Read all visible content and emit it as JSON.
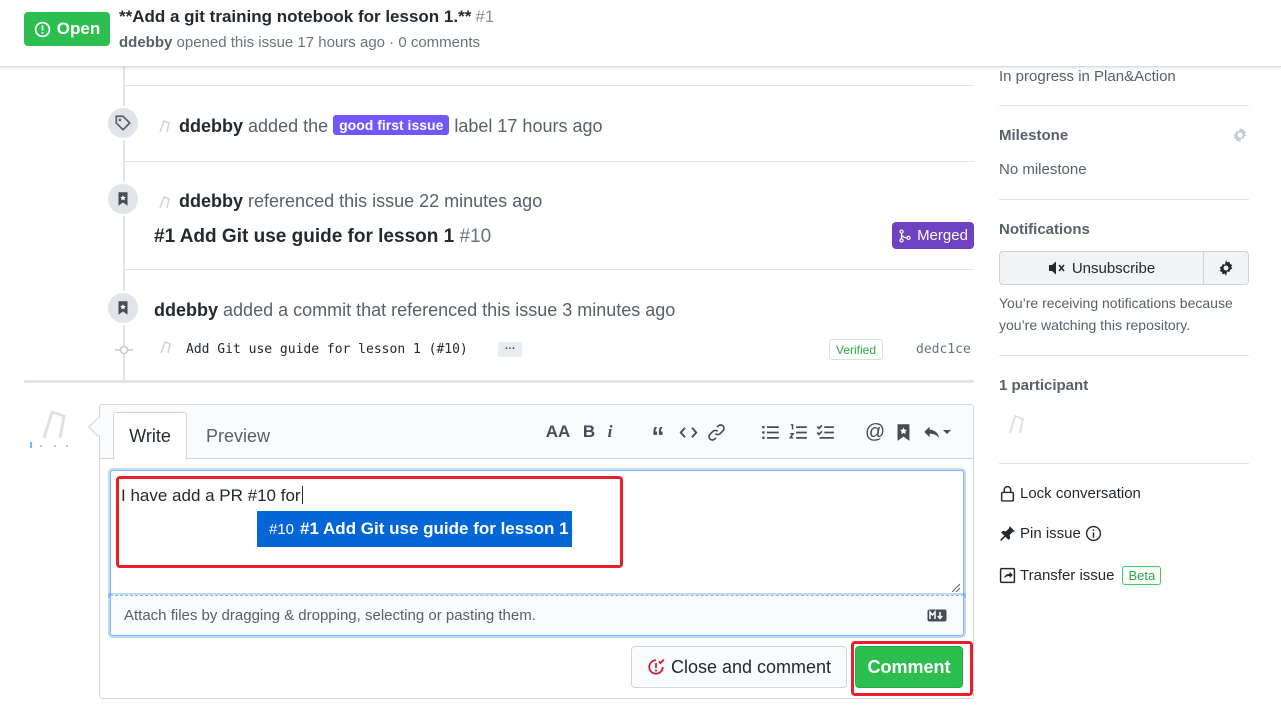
{
  "header": {
    "state_label": "Open",
    "title": "**Add a git training notebook for lesson 1.**",
    "number": "#1",
    "author": "ddebby",
    "meta": "opened this issue 17 hours ago · 0 comments"
  },
  "timeline": {
    "label_event": {
      "actor": "ddebby",
      "verb": "added the",
      "label": "good first issue",
      "label_color": "#7057ff",
      "suffix": "label 17 hours ago"
    },
    "ref_event": {
      "actor": "ddebby",
      "text": "referenced this issue 22 minutes ago",
      "pr_title": "#1 Add Git use guide for lesson 1",
      "pr_number": "#10",
      "state": "Merged",
      "state_color": "#6f42c1"
    },
    "commit_event": {
      "actor": "ddebby",
      "text": "added a commit that referenced this issue 3 minutes ago",
      "message": "Add Git use guide for lesson 1 (#10)",
      "more": "…",
      "verified": "Verified",
      "sha": "dedc1ce"
    }
  },
  "comment_form": {
    "tabs": [
      "Write",
      "Preview"
    ],
    "active_tab": "Write",
    "toolbar": {
      "heading": "AA",
      "bold": "B",
      "italic": "i",
      "quote": "“",
      "mention": "@"
    },
    "text": "I have add a PR #10 for",
    "suggestion": {
      "number": "#10",
      "title": "#1 Add Git use guide for lesson 1"
    },
    "attach_hint": "Attach files by dragging & dropping, selecting or pasting them.",
    "close_button": "Close and comment",
    "comment_button": "Comment"
  },
  "sidebar": {
    "project_status": "In progress in Plan&Action",
    "milestone_heading": "Milestone",
    "milestone_value": "No milestone",
    "notifications_heading": "Notifications",
    "unsubscribe_label": "Unsubscribe",
    "notifications_reason": [
      "You’re receiving notifications because",
      "you’re watching this repository."
    ],
    "participants_heading": "1 participant",
    "lock_label": "Lock conversation",
    "pin_label": "Pin issue",
    "transfer_label": "Transfer issue",
    "beta_label": "Beta"
  },
  "colors": {
    "open_green": "#2cbe4e",
    "link_blue": "#0366d6",
    "highlight_red": "#e8202a"
  }
}
